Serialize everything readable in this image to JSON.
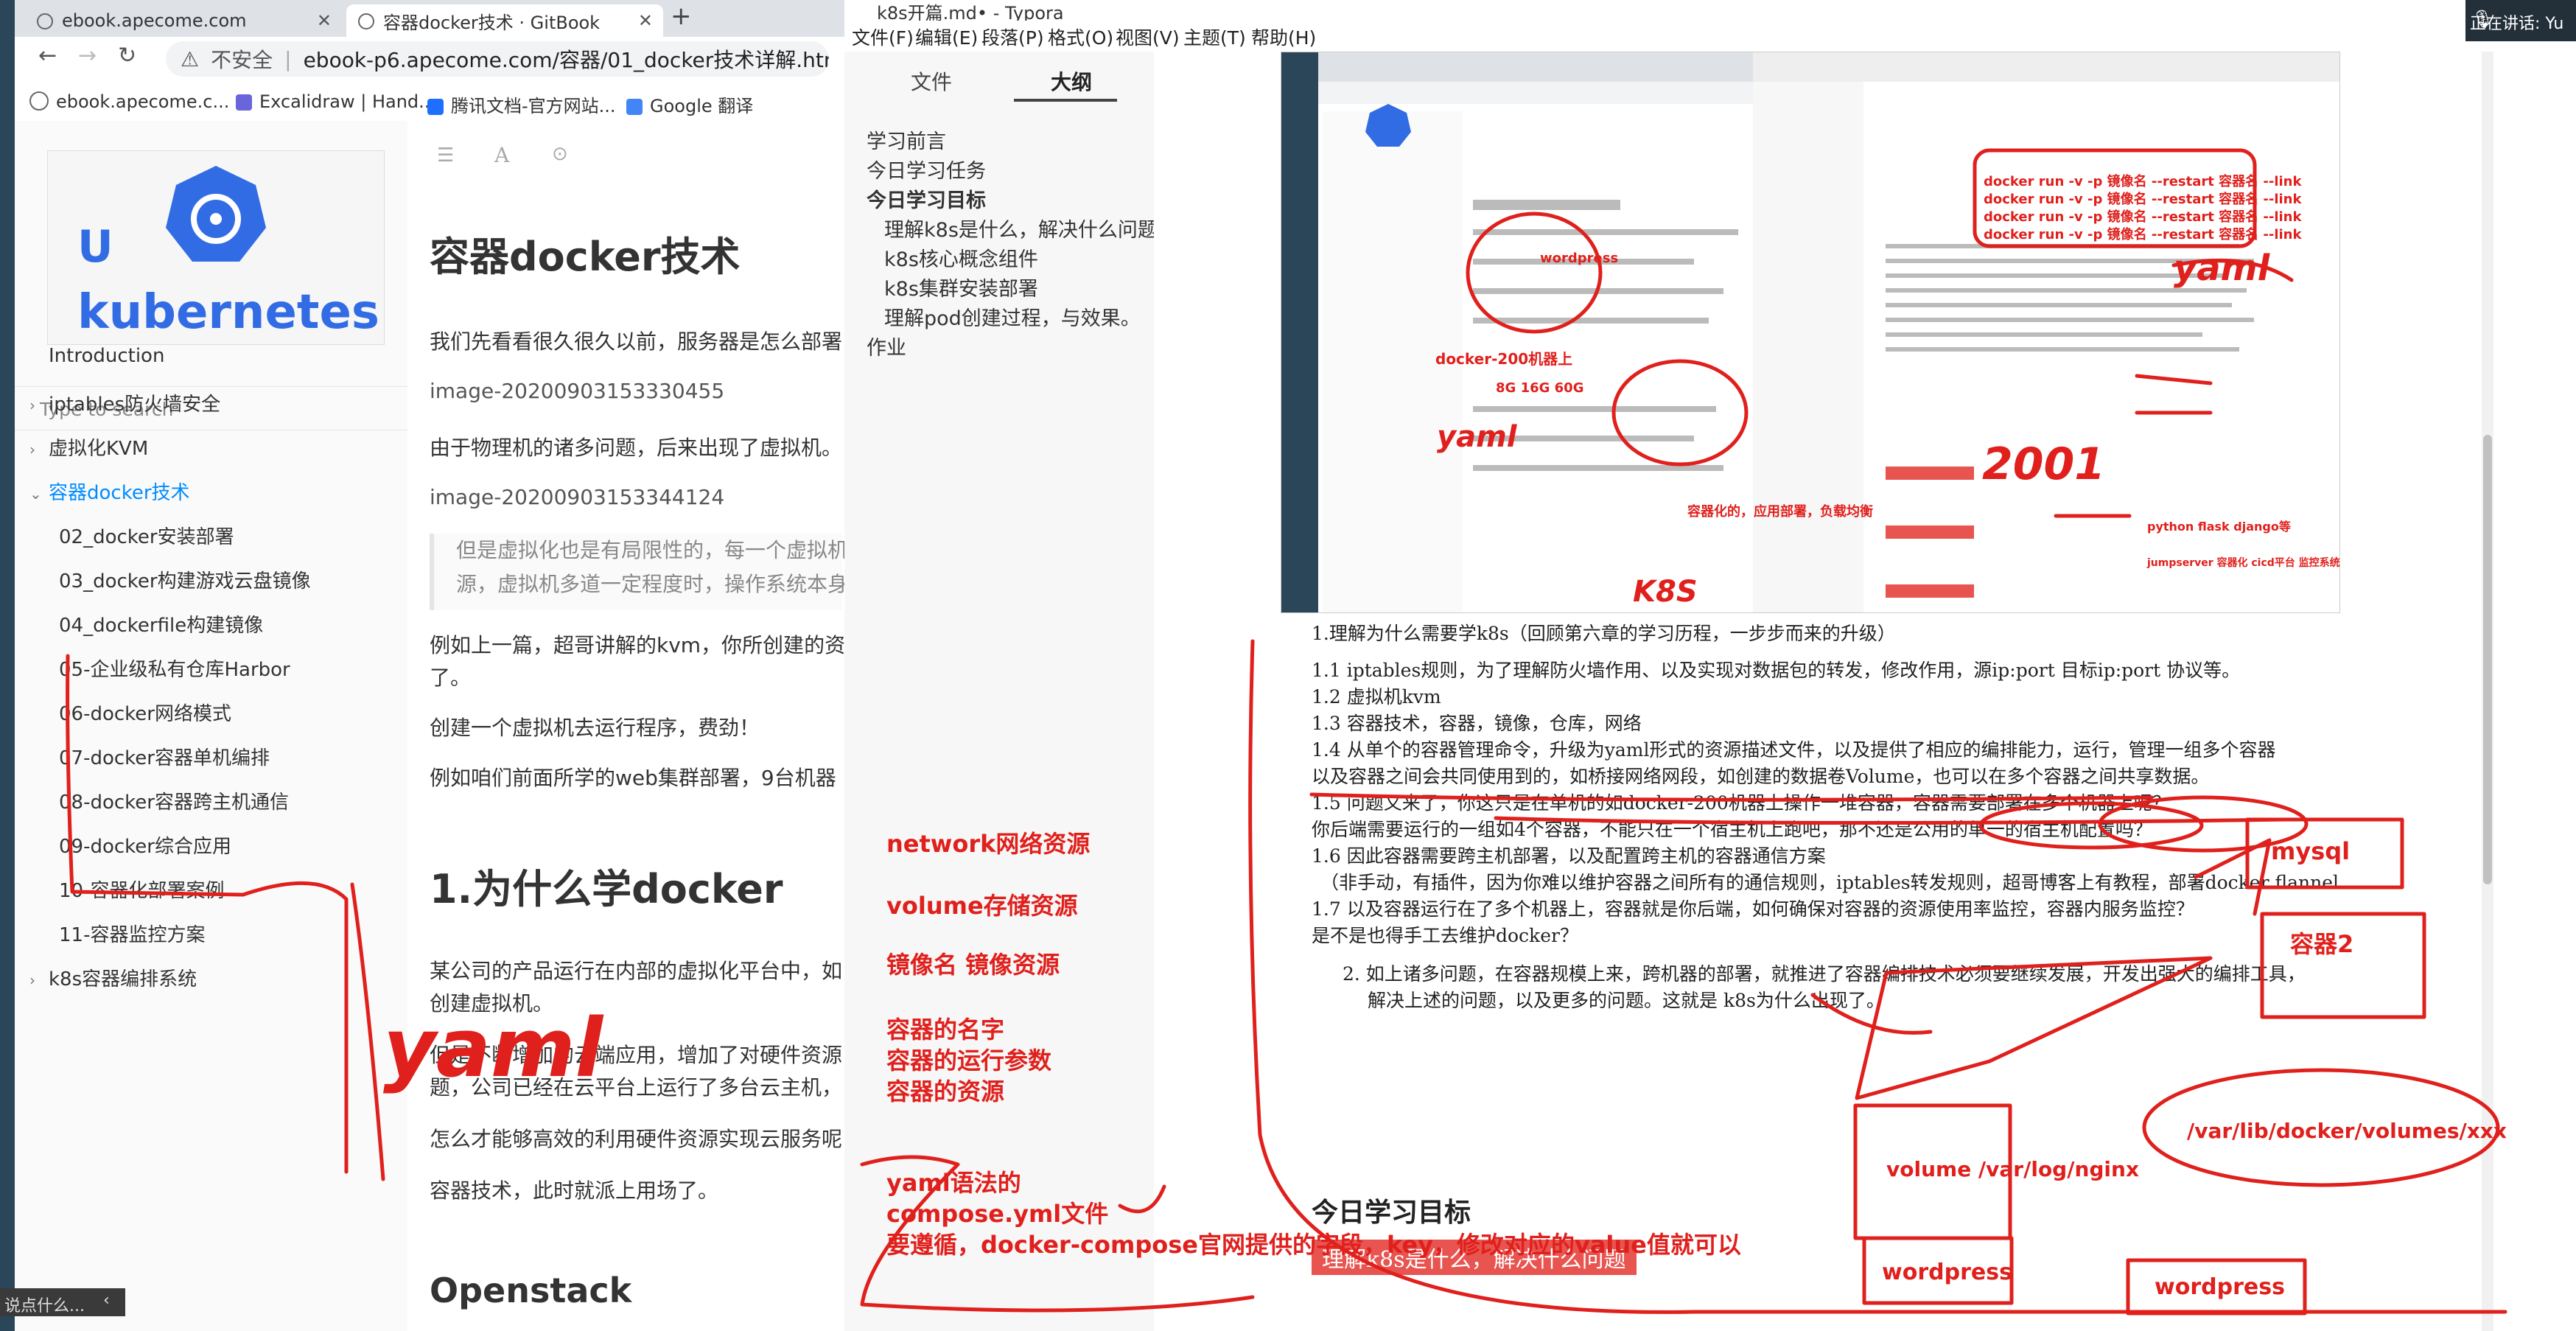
{
  "chrome": {
    "tabs": [
      {
        "title": "ebook.apecome.com"
      },
      {
        "title": "容器docker技术 · GitBook"
      }
    ],
    "new_tab_glyph": "+",
    "url_security": "不安全",
    "url": "ebook-p6.apecome.com/容器/01_docker技术详解.html",
    "bookmarks": [
      "ebook.apecome.c...",
      "Excalidraw | Hand...",
      "腾讯文档-官方网站...",
      "Google 翻译"
    ]
  },
  "gitbook": {
    "search_placeholder": "Type to search",
    "nav": [
      {
        "label": "Introduction",
        "level": 0
      },
      {
        "label": "iptables防火墙安全",
        "level": 0
      },
      {
        "label": "虚拟化KVM",
        "level": 0
      },
      {
        "label": "容器docker技术",
        "level": 0,
        "active": true
      },
      {
        "label": "02_docker安装部署",
        "level": 1
      },
      {
        "label": "03_docker构建游戏云盘镜像",
        "level": 1
      },
      {
        "label": "04_dockerfile构建镜像",
        "level": 1
      },
      {
        "label": "05-企业级私有仓库Harbor",
        "level": 1
      },
      {
        "label": "06-docker网络模式",
        "level": 1
      },
      {
        "label": "07-docker容器单机编排",
        "level": 1
      },
      {
        "label": "08-docker容器跨主机通信",
        "level": 1
      },
      {
        "label": "09-docker综合应用",
        "level": 1
      },
      {
        "label": "10-容器化部署案例",
        "level": 1
      },
      {
        "label": "11-容器监控方案",
        "level": 1
      },
      {
        "label": "k8s容器编排系统",
        "level": 0
      }
    ],
    "page_title": "容器docker技术",
    "p1": "我们先看看很久很久以前，服务器是怎么部署",
    "img1": "image-20200903153330455",
    "p2": "由于物理机的诸多问题，后来出现了虚拟机。",
    "img2": "image-20200903153344124",
    "quote1": "但是虚拟化也是有局限性的，每一个虚拟机",
    "quote2": "源，虚拟机多道一定程度时，操作系统本身",
    "p3": "例如上一篇，超哥讲解的kvm，你所创建的资",
    "p3b": "了。",
    "p4": "创建一个虚拟机去运行程序，费劲！",
    "p5": "例如咱们前面所学的web集群部署，9台机器",
    "h1": "1.为什么学docker",
    "p6": "某公司的产品运行在内部的虚拟化平台中，如",
    "p6b": "创建虚拟机。",
    "p7": "但是不断增加的云端应用，增加了对硬件资源",
    "p7b": "题，公司已经在云平台上运行了多台云主机，",
    "p8": "怎么才能够高效的利用硬件资源实现云服务呢",
    "p9": "容器技术，此时就派上用场了。",
    "h2": "Openstack"
  },
  "typora": {
    "title": "k8s开篇.md• - Typora",
    "menu": [
      "文件(F)",
      "编辑(E)",
      "段落(P)",
      "格式(O)",
      "视图(V)",
      "主题(T)",
      "帮助(H)"
    ],
    "side_tabs": [
      "文件",
      "大纲"
    ],
    "outline": [
      {
        "label": "学习前言",
        "level": 0
      },
      {
        "label": "今日学习任务",
        "level": 0
      },
      {
        "label": "今日学习目标",
        "level": 0,
        "bold": true
      },
      {
        "label": "理解k8s是什么，解决什么问题",
        "level": 1
      },
      {
        "label": "k8s核心概念组件",
        "level": 1
      },
      {
        "label": "k8s集群安装部署",
        "level": 1
      },
      {
        "label": "理解pod创建过程，与效果。",
        "level": 1
      },
      {
        "label": "作业",
        "level": 0
      }
    ],
    "doc": {
      "l1": "1.理解为什么需要学k8s（回顾第六章的学习历程，一步步而来的升级）",
      "l2": "1.1 iptables规则，为了理解防火墙作用、以及实现对数据包的转发，修改作用，源ip:port 目标ip:port 协议等。",
      "l3": "1.2 虚拟机kvm",
      "l4": "1.3 容器技术，容器，镜像，仓库，网络",
      "l5": "1.4 从单个的容器管理命令，升级为yaml形式的资源描述文件，以及提供了相应的编排能力，运行，管理一组多个容器",
      "l6": "以及容器之间会共同使用到的，如桥接网络网段，如创建的数据卷Volume，也可以在多个容器之间共享数据。",
      "l7": "1.5 问题又来了，你这只是在单机的如docker-200机器上操作一堆容器，容器需要部署在多个机器上呢？",
      "l8": "你后端需要运行的一组如4个容器，不能只在一个宿主机上跑吧，那不还是公用的单一的宿主机配置吗？",
      "l9": "1.6 因此容器需要跨主机部署，以及配置跨主机的容器通信方案",
      "l10": "（非手动，有插件，因为你难以维护容器之间所有的通信规则，iptables转发规则，超哥博客上有教程，部署docker flannel",
      "l11": "1.7 以及容器运行在了多个机器上，容器就是你后端，如何确保对容器的资源使用率监控，容器内服务监控？",
      "l12": "是不是也得手工去维护docker？",
      "l13": "2. 如上诸多问题，在容器规模上来，跨机器的部署，就推进了容器编排技术必须要继续发展，开发出强大的编排工具，",
      "l14": "解决上述的问题，以及更多的问题。这就是 k8s为什么出现了。",
      "h_goal": "今日学习目标",
      "goal_item": "理解k8s是什么，解决什么问题"
    }
  },
  "annotations": {
    "left": [
      "network网络资源",
      "volume存储资源",
      "镜像名  镜像资源",
      "容器的名字",
      "容器的运行参数",
      "容器的资源",
      "yaml语法的",
      "compose.yml文件",
      "要遵循，docker-compose官网提供的字段，key，修改对应的value值就可以"
    ],
    "right": [
      "mysql",
      "容器2",
      "/var/lib/docker/volumes/xxx",
      "volume /var/log/nginx",
      "wordpress",
      "wordpress"
    ],
    "sidebar_scribble": "yaml",
    "shot_scribbles": [
      "docker run -v -p 镜像名 --restart 容器名 --link",
      "docker run -v -p 镜像名 --restart 容器名 --link",
      "docker run -v -p 镜像名 --restart 容器名 --link",
      "docker run -v -p 镜像名 --restart 容器名 --link",
      "yaml",
      "wordpress",
      "docker-200机器上",
      "8G 16G 60G",
      "yaml",
      "容器化的，应用部署，负载均衡",
      "python flask django等",
      "jumpserver 容器化 cicd平台 监控系统",
      "2001",
      "K8S"
    ]
  },
  "status": {
    "speaking": "正在讲话: Yu",
    "taskbar_text": "说点什么..."
  },
  "colors": {
    "ink": "#e0201c",
    "link": "#008cff"
  }
}
